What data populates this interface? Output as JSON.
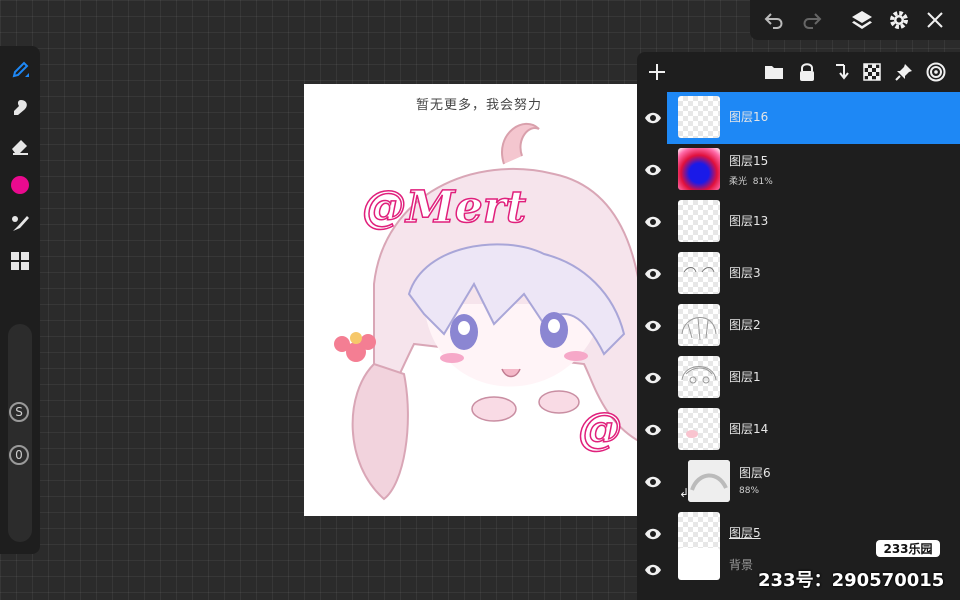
{
  "colors": {
    "accent": "#1e88f5",
    "current_color": "#ea0a8e",
    "panel_bg": "#1e1e1e"
  },
  "left_toolbar": {
    "tools": [
      "brush-icon",
      "smudge-icon",
      "eraser-icon",
      "color-swatch",
      "brush-settings-icon",
      "grid-icon"
    ],
    "size_label": "S",
    "opacity_label": "0"
  },
  "top_bar": {
    "icons": [
      "undo-icon",
      "redo-icon",
      "layers-icon",
      "settings-icon",
      "close-icon"
    ]
  },
  "canvas": {
    "watermark": "暂无更多，我会努力",
    "signature_main": "@Mert",
    "signature_partial": "@"
  },
  "layers_panel": {
    "header_icons": [
      "add-layer-icon",
      "folder-icon",
      "lock-icon",
      "merge-down-icon",
      "transparency-icon",
      "pin-icon",
      "target-icon"
    ],
    "layers": [
      {
        "name": "图层16",
        "selected": true
      },
      {
        "name": "图层15",
        "blend": "柔光",
        "opacity": "81%"
      },
      {
        "name": "图层13"
      },
      {
        "name": "图层3"
      },
      {
        "name": "图层2"
      },
      {
        "name": "图层1"
      },
      {
        "name": "图层14"
      },
      {
        "name": "图层6",
        "opacity": "88%",
        "clipped": true
      },
      {
        "name": "图层5"
      },
      {
        "name": "背景"
      }
    ]
  },
  "branding": {
    "badge": "233乐园",
    "id_text": "233号：290570015"
  }
}
